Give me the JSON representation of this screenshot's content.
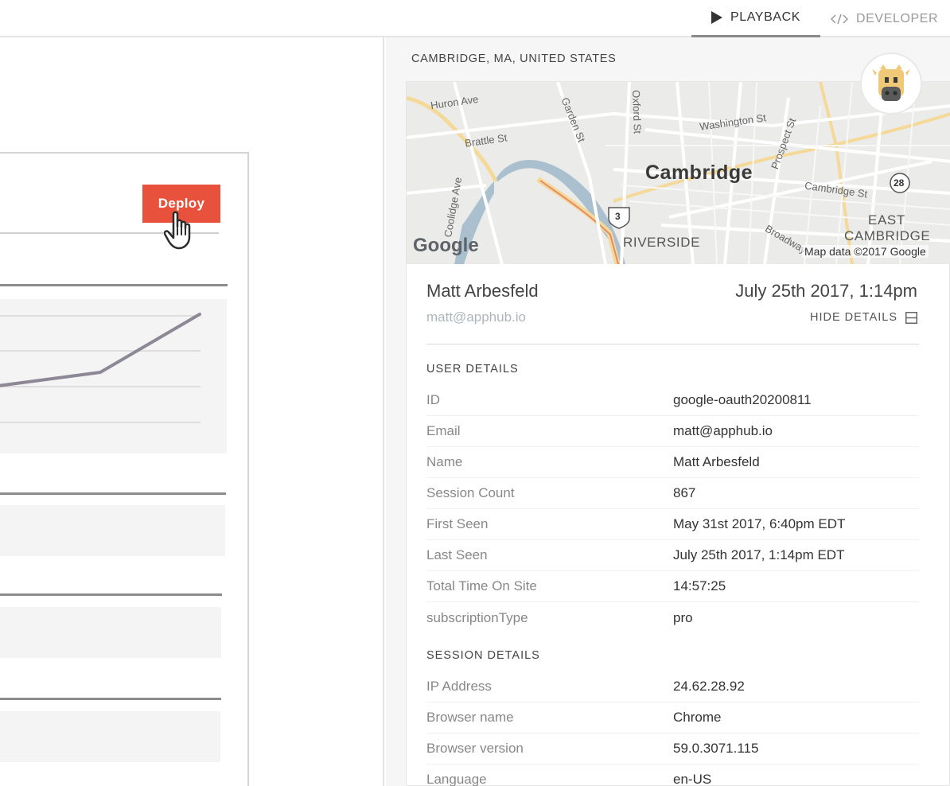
{
  "tabs": {
    "playback": "PLAYBACK",
    "developer": "DEVELOPER"
  },
  "replay": {
    "deploy_label": "Deploy"
  },
  "location": "CAMBRIDGE, MA, UNITED STATES",
  "map": {
    "city": "Cambridge",
    "streets": [
      "Huron Ave",
      "Brattle St",
      "Garden St",
      "Oxford St",
      "Washington St",
      "Prospect St",
      "Cambridge St",
      "Broadway",
      "Coolidge Ave"
    ],
    "districts": [
      "RIVERSIDE",
      "EAST",
      "CAMBRIDGE"
    ],
    "route_shields": [
      "3",
      "28"
    ],
    "logo": "Google",
    "attribution": "Map data ©2017 Google"
  },
  "user": {
    "name": "Matt Arbesfeld",
    "email": "matt@apphub.io",
    "timestamp": "July 25th 2017, 1:14pm",
    "hide_details_label": "HIDE DETAILS"
  },
  "user_details": {
    "title": "USER DETAILS",
    "rows": [
      {
        "key": "ID",
        "value": "google-oauth20200811"
      },
      {
        "key": "Email",
        "value": "matt@apphub.io"
      },
      {
        "key": "Name",
        "value": "Matt Arbesfeld"
      },
      {
        "key": "Session Count",
        "value": "867"
      },
      {
        "key": "First Seen",
        "value": "May 31st 2017, 6:40pm EDT"
      },
      {
        "key": "Last Seen",
        "value": "July 25th 2017, 1:14pm EDT"
      },
      {
        "key": "Total Time On Site",
        "value": "14:57:25"
      },
      {
        "key": "subscriptionType",
        "value": "pro"
      }
    ]
  },
  "session_details": {
    "title": "SESSION DETAILS",
    "rows": [
      {
        "key": "IP Address",
        "value": "24.62.28.92"
      },
      {
        "key": "Browser name",
        "value": "Chrome"
      },
      {
        "key": "Browser version",
        "value": "59.0.3071.115"
      },
      {
        "key": "Language",
        "value": "en-US"
      }
    ]
  },
  "colors": {
    "deploy_button": "#e8513b",
    "email_muted": "#aeb6bd",
    "avatar_face": "#f0c978"
  },
  "icons": {
    "playback": "play-icon",
    "developer": "code-icon",
    "hide_details": "collapse-icon",
    "cursor": "hand-pointer-icon",
    "avatar": "cow-avatar-icon"
  }
}
